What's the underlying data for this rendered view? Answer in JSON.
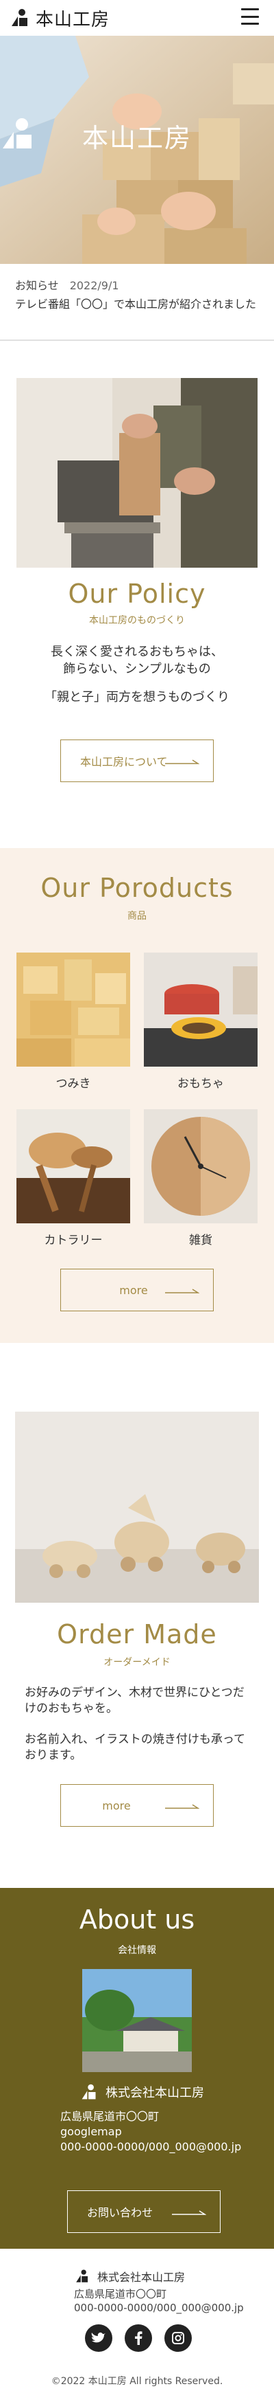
{
  "header": {
    "logo_text": "本山工房",
    "menu_icon": "hamburger-menu-icon"
  },
  "hero": {
    "logo_text": "本山工房"
  },
  "news": {
    "label": "お知らせ",
    "date": "2022/9/1",
    "title": "テレビ番組「〇〇」で本山工房が紹介されました"
  },
  "policy": {
    "title": "Our Policy",
    "subtitle": "本山工房のものづくり",
    "line1": "長く深く愛されるおもちゃは、",
    "line2": "飾らない、シンプルなもの",
    "line3": "「親と子」両方を想うものづくり",
    "button": "本山工房について"
  },
  "products": {
    "title": "Our Poroducts",
    "subtitle": "商品",
    "items": [
      {
        "label": "つみき"
      },
      {
        "label": "おもちゃ"
      },
      {
        "label": "カトラリー"
      },
      {
        "label": "雑貨"
      }
    ],
    "more": "more"
  },
  "order": {
    "title": "Order Made",
    "subtitle": "オーダーメイド",
    "p1": "お好みのデザイン、木材で世界にひとつだけのおもちゃを。",
    "p2": "お名前入れ、イラストの焼き付けも承っております。",
    "more": "more"
  },
  "about": {
    "title": "About us",
    "subtitle": "会社情報",
    "company": "株式会社本山工房",
    "address": "広島県尾道市〇〇町",
    "map": "googlemap",
    "contact": "000-0000-0000/000_000@000.jp",
    "button": "お問い合わせ"
  },
  "footer": {
    "company": "株式会社本山工房",
    "address": "広島県尾道市〇〇町",
    "contact": "000-0000-0000/000_000@000.jp",
    "socials": [
      "twitter-icon",
      "facebook-icon",
      "instagram-icon"
    ],
    "copyright": "©2022 本山工房 All rights Reserved."
  },
  "colors": {
    "accent": "#a38b46",
    "about_bg": "#6b5f1f",
    "products_bg": "#faf1e8"
  }
}
